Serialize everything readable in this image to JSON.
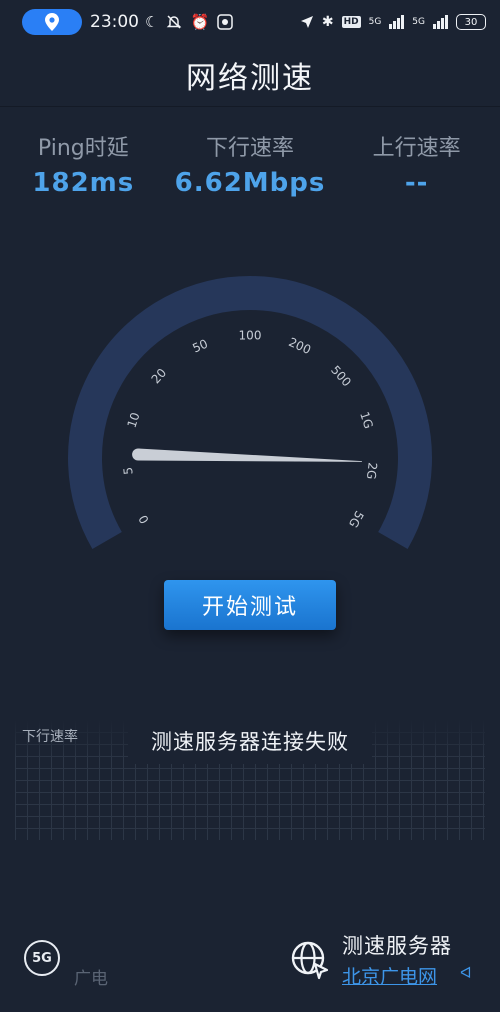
{
  "status_bar": {
    "time": "23:00",
    "network_type": "5G",
    "network_type_2": "5G",
    "hd_badge": "HD",
    "battery": "30"
  },
  "header": {
    "title": "网络测速"
  },
  "metrics": [
    {
      "label": "Ping时延",
      "value": "182ms"
    },
    {
      "label": "下行速率",
      "value": "6.62Mbps"
    },
    {
      "label": "上行速率",
      "value": "--"
    }
  ],
  "gauge": {
    "tick_labels": [
      "0",
      "5",
      "10",
      "20",
      "50",
      "100",
      "200",
      "500",
      "1G",
      "2G",
      "5G"
    ],
    "current_speed_mbps": 6.62
  },
  "start_button": {
    "label": "开始测试"
  },
  "graph": {
    "label": "下行速率",
    "message": "测速服务器连接失败"
  },
  "footer": {
    "network_badge": "5G",
    "network_name": "广电",
    "server_label": "测速服务器",
    "server_value": "北京广电网"
  },
  "colors": {
    "background": "#1b2332",
    "accent": "#2a7ff5",
    "metric_value": "#4ea3ea",
    "button": "#1f82dd",
    "gauge_arc": "#26375a"
  }
}
